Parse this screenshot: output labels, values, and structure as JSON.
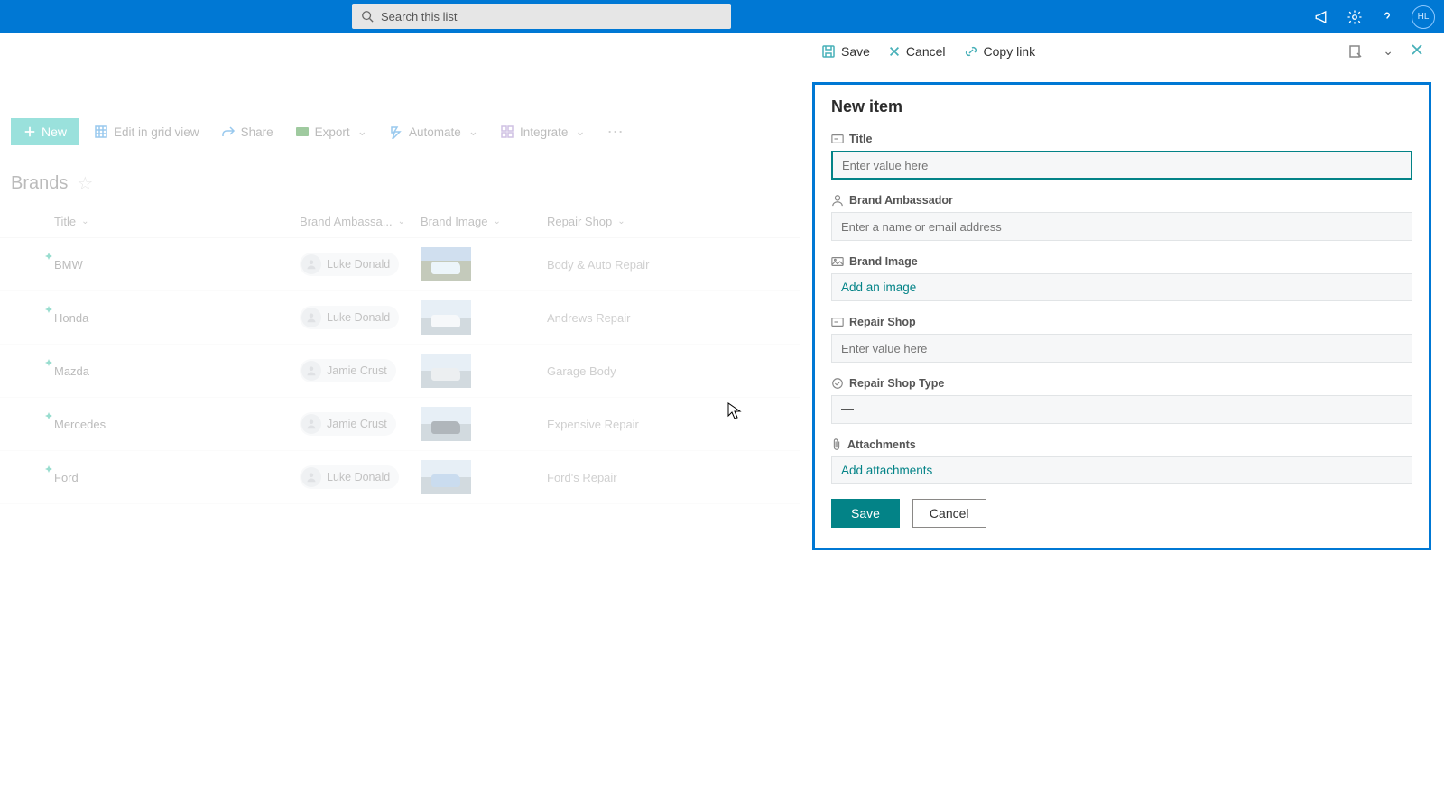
{
  "suite": {
    "search_placeholder": "Search this list",
    "avatar": "HL"
  },
  "toolbar": {
    "new": "New",
    "edit_grid": "Edit in grid view",
    "share": "Share",
    "export": "Export",
    "automate": "Automate",
    "integrate": "Integrate"
  },
  "list": {
    "title": "Brands",
    "columns": {
      "title": "Title",
      "ambassador": "Brand Ambassa...",
      "image": "Brand Image",
      "shop": "Repair Shop"
    },
    "rows": [
      {
        "title": "BMW",
        "ambassador": "Luke Donald",
        "shop": "Body & Auto Repair"
      },
      {
        "title": "Honda",
        "ambassador": "Luke Donald",
        "shop": "Andrews Repair"
      },
      {
        "title": "Mazda",
        "ambassador": "Jamie Crust",
        "shop": "Garage Body"
      },
      {
        "title": "Mercedes",
        "ambassador": "Jamie Crust",
        "shop": "Expensive Repair"
      },
      {
        "title": "Ford",
        "ambassador": "Luke Donald",
        "shop": "Ford's Repair"
      }
    ]
  },
  "panel": {
    "save": "Save",
    "cancel": "Cancel",
    "copy_link": "Copy link",
    "title": "New item",
    "fields": {
      "title_label": "Title",
      "title_placeholder": "Enter value here",
      "ambassador_label": "Brand Ambassador",
      "ambassador_placeholder": "Enter a name or email address",
      "image_label": "Brand Image",
      "image_action": "Add an image",
      "shop_label": "Repair Shop",
      "shop_placeholder": "Enter value here",
      "shop_type_label": "Repair Shop Type",
      "attachments_label": "Attachments",
      "attachments_action": "Add attachments"
    },
    "buttons": {
      "save": "Save",
      "cancel": "Cancel"
    }
  }
}
